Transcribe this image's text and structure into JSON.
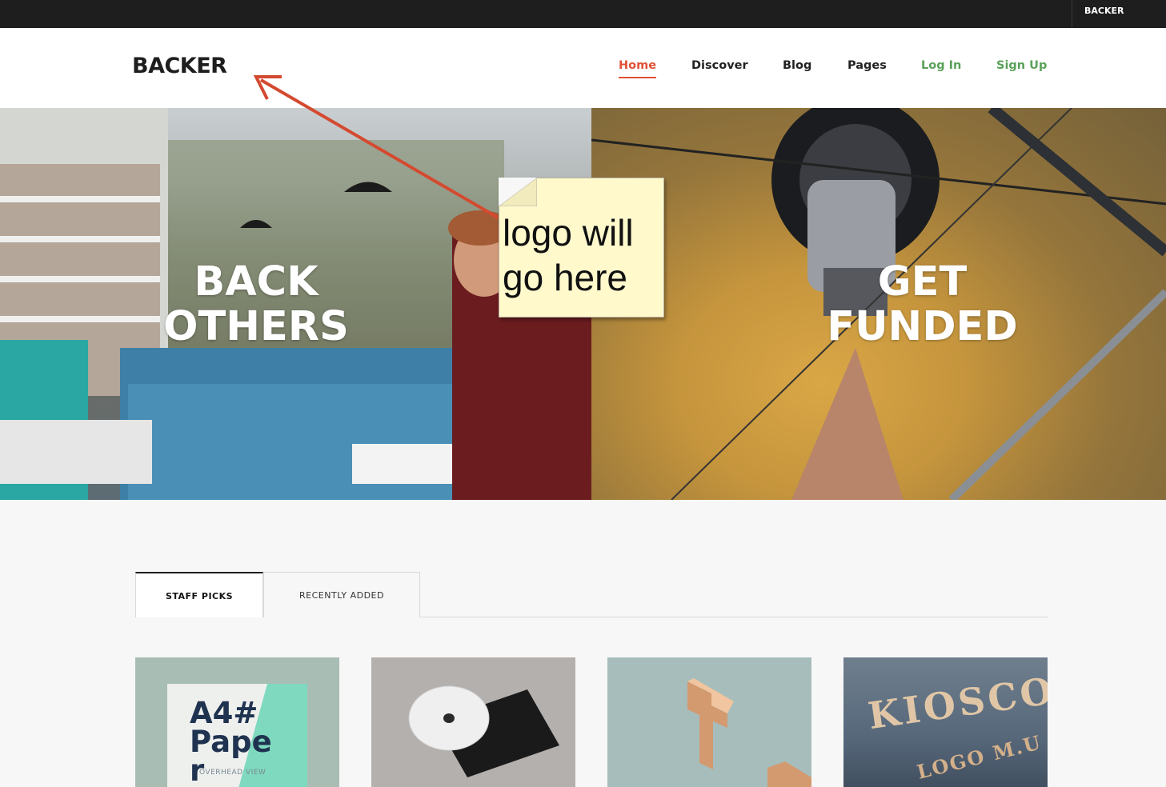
{
  "topbar": {
    "brand": "BACKER"
  },
  "header": {
    "logo": "BACKER",
    "nav": [
      {
        "label": "Home",
        "active": true
      },
      {
        "label": "Discover"
      },
      {
        "label": "Blog"
      },
      {
        "label": "Pages"
      },
      {
        "label": "Log In"
      },
      {
        "label": "Sign Up"
      }
    ]
  },
  "hero": {
    "left_title_line1": "BACK",
    "left_title_line2": "OTHERS",
    "right_title_line1": "GET",
    "right_title_line2": "FUNDED"
  },
  "annotation": {
    "note": "logo will\ngo here",
    "arrow_color": "#d44a30",
    "note_color": "#fff9cc"
  },
  "tabs": [
    {
      "label": "STAFF PICKS",
      "active": true
    },
    {
      "label": "RECENTLY ADDED"
    }
  ],
  "cards": [
    {
      "text_line1": "A4#",
      "text_line2": "Pape",
      "text_line3": "r",
      "caption": "OVERHEAD VIEW"
    },
    {
      "disc_label": ""
    },
    {},
    {
      "text_line1": "KIOSCO",
      "text_line2": "LOGO M.U"
    }
  ],
  "colors": {
    "accent": "#e05138",
    "green": "#5aa15a",
    "dark": "#1e1e1e"
  }
}
